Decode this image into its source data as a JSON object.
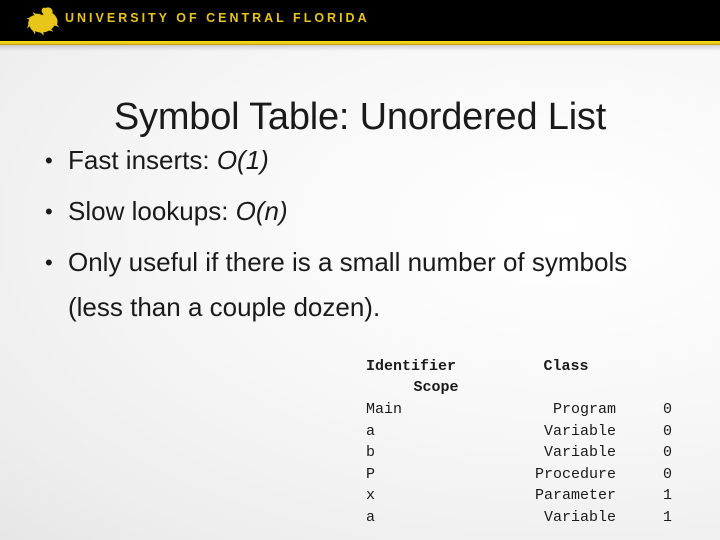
{
  "header": {
    "institution": "UNIVERSITY OF CENTRAL FLORIDA",
    "logo_icon": "pegasus-logo-icon",
    "band_color": "#000000",
    "rule_color": "#f2cf10",
    "text_color": "#e8c519"
  },
  "slide": {
    "title": "Symbol Table: Unordered List",
    "background_color": "#ededed",
    "text_color": "#1a1a1a"
  },
  "bullets": [
    {
      "marker": "•",
      "text": "Fast inserts: ",
      "emphasis": "O(1)",
      "tail": ""
    },
    {
      "marker": "•",
      "text": "Slow lookups: ",
      "emphasis": "O(n)",
      "tail": ""
    },
    {
      "marker": "•",
      "text": "Only useful if there is a small number of symbols (less than a couple dozen).",
      "emphasis": "",
      "tail": ""
    }
  ],
  "symbol_table": {
    "headers": {
      "identifier": "Identifier",
      "class": "Class",
      "scope": "Scope"
    },
    "rows": [
      {
        "identifier": "Main",
        "class": "Program",
        "scope": "0"
      },
      {
        "identifier": "a",
        "class": "Variable",
        "scope": "0"
      },
      {
        "identifier": "b",
        "class": "Variable",
        "scope": "0"
      },
      {
        "identifier": "P",
        "class": "Procedure",
        "scope": "0"
      },
      {
        "identifier": "x",
        "class": "Parameter",
        "scope": "1"
      },
      {
        "identifier": "a",
        "class": "Variable",
        "scope": "1"
      }
    ]
  }
}
